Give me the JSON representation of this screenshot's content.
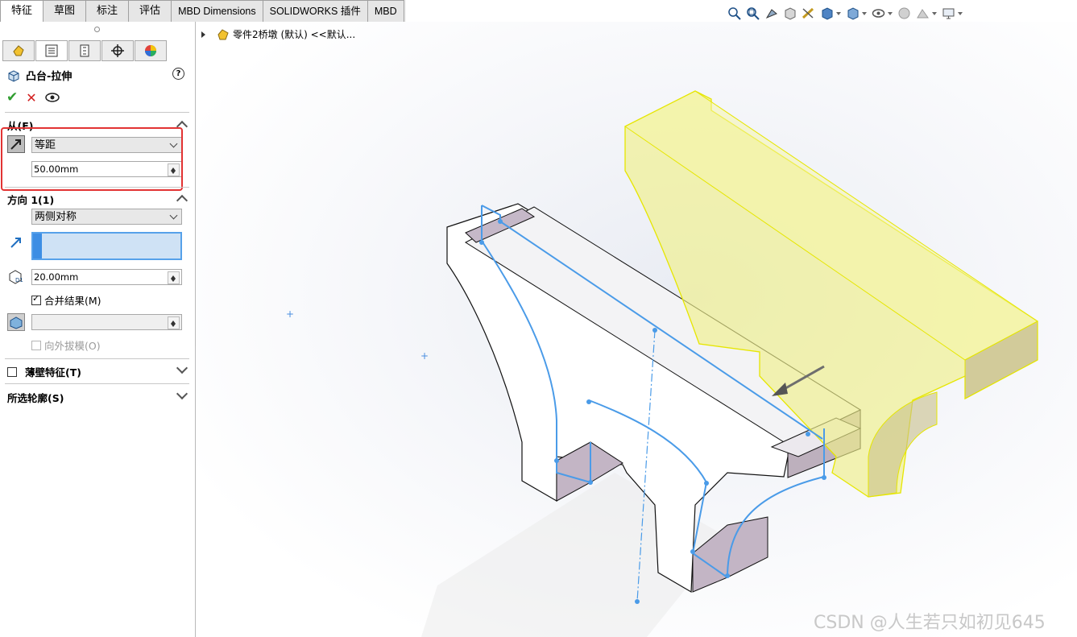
{
  "tabs": [
    {
      "label": "特征"
    },
    {
      "label": "草图"
    },
    {
      "label": "标注"
    },
    {
      "label": "评估"
    },
    {
      "label": "MBD Dimensions"
    },
    {
      "label": "SOLIDWORKS 插件"
    },
    {
      "label": "MBD"
    }
  ],
  "feature": {
    "title": "凸台-拉伸",
    "help": "?",
    "from_section": "从(F)",
    "from_condition": "等距",
    "from_offset": "50.00mm",
    "direction_section": "方向 1(1)",
    "direction_condition": "两侧对称",
    "depth": "20.00mm",
    "merge_label": "合并结果(M)",
    "merge_checked": true,
    "draft_value": "",
    "draft_out_label": "向外拔模(O)",
    "thin_feature": "薄壁特征(T)",
    "selected_contours": "所选轮廓(S)"
  },
  "tree": {
    "label": "零件2桥墩 (默认) <<默认..."
  },
  "watermark": "CSDN @人生若只如初见645",
  "colors": {
    "accent_blue": "#56a1ea",
    "highlight_red": "#e23333",
    "preview_yellow": "#f0f08a",
    "sketch_blue": "#4a9be8"
  }
}
